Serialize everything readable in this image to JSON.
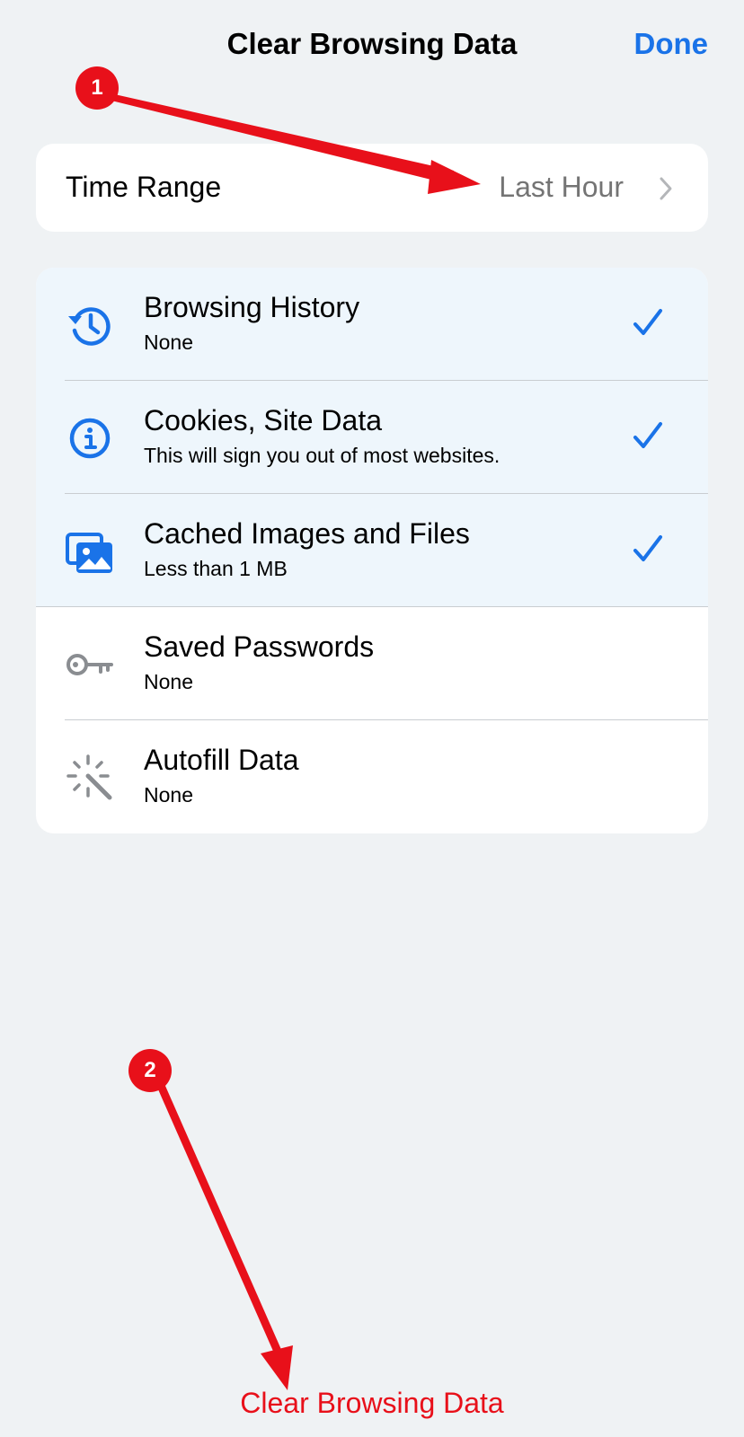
{
  "header": {
    "title": "Clear Browsing Data",
    "done_label": "Done"
  },
  "time_range": {
    "label": "Time Range",
    "value": "Last Hour",
    "chevron_icon": "chevron-right-icon"
  },
  "items": [
    {
      "title": "Browsing History",
      "subtitle": "None",
      "icon": "history-icon",
      "selected": true
    },
    {
      "title": "Cookies, Site Data",
      "subtitle": "This will sign you out of most websites.",
      "icon": "info-icon",
      "selected": true
    },
    {
      "title": "Cached Images and Files",
      "subtitle": "Less than 1 MB",
      "icon": "images-icon",
      "selected": true
    },
    {
      "title": "Saved Passwords",
      "subtitle": "None",
      "icon": "key-icon",
      "selected": false
    },
    {
      "title": "Autofill Data",
      "subtitle": "None",
      "icon": "magic-wand-icon",
      "selected": false
    }
  ],
  "annotations": {
    "step1": "1",
    "step2": "2"
  },
  "footer": {
    "clear_label": "Clear Browsing Data"
  },
  "colors": {
    "accent": "#1a73e8",
    "annotation": "#e8101a",
    "background": "#eff2f4",
    "selected_row": "#eef6fc"
  }
}
